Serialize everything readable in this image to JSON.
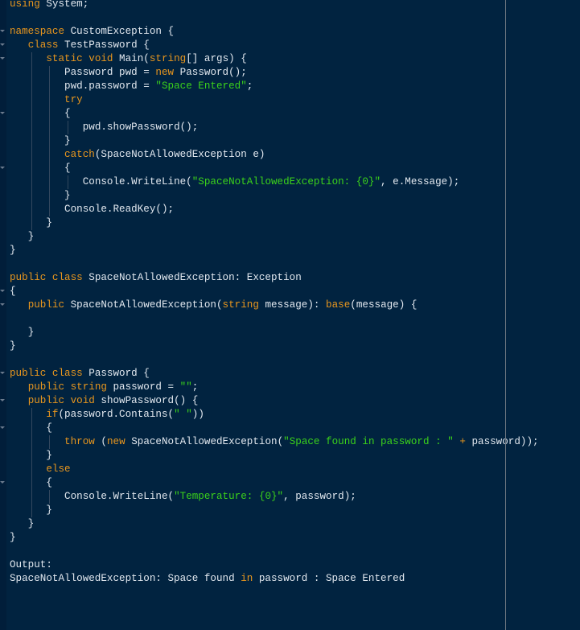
{
  "editor": {
    "indent_unit": "   ",
    "colors": {
      "background": "#012340",
      "keyword": "#e8961e",
      "string": "#3bd21a",
      "text": "#e2e8ef",
      "ruler": "#6e7781"
    },
    "lines": [
      {
        "indent": 0,
        "fold": false,
        "tokens": [
          {
            "t": "using",
            "k": "kw"
          },
          {
            "t": " System;"
          }
        ]
      },
      {
        "indent": 0,
        "fold": false,
        "tokens": []
      },
      {
        "indent": 0,
        "fold": true,
        "tokens": [
          {
            "t": "namespace",
            "k": "kw"
          },
          {
            "t": " CustomException {"
          }
        ]
      },
      {
        "indent": 1,
        "fold": true,
        "tokens": [
          {
            "t": "class",
            "k": "kw"
          },
          {
            "t": " TestPassword {"
          }
        ]
      },
      {
        "indent": 2,
        "fold": true,
        "tokens": [
          {
            "t": "static void",
            "k": "kw"
          },
          {
            "t": " Main("
          },
          {
            "t": "string",
            "k": "kw"
          },
          {
            "t": "[] args) {"
          }
        ]
      },
      {
        "indent": 3,
        "fold": false,
        "tokens": [
          {
            "t": "Password pwd = "
          },
          {
            "t": "new",
            "k": "kw"
          },
          {
            "t": " Password();"
          }
        ]
      },
      {
        "indent": 3,
        "fold": false,
        "tokens": [
          {
            "t": "pwd.password = "
          },
          {
            "t": "\"Space Entered\"",
            "k": "str"
          },
          {
            "t": ";"
          }
        ]
      },
      {
        "indent": 3,
        "fold": false,
        "tokens": [
          {
            "t": "try",
            "k": "kw"
          }
        ]
      },
      {
        "indent": 3,
        "fold": true,
        "tokens": [
          {
            "t": "{"
          }
        ]
      },
      {
        "indent": 4,
        "fold": false,
        "tokens": [
          {
            "t": "pwd.showPassword();"
          }
        ]
      },
      {
        "indent": 3,
        "fold": false,
        "tokens": [
          {
            "t": "}"
          }
        ]
      },
      {
        "indent": 3,
        "fold": false,
        "tokens": [
          {
            "t": "catch",
            "k": "kw"
          },
          {
            "t": "(SpaceNotAllowedException e)"
          }
        ]
      },
      {
        "indent": 3,
        "fold": true,
        "tokens": [
          {
            "t": "{"
          }
        ]
      },
      {
        "indent": 4,
        "fold": false,
        "tokens": [
          {
            "t": "Console.WriteLine("
          },
          {
            "t": "\"SpaceNotAllowedException: {0}\"",
            "k": "str"
          },
          {
            "t": ", e.Message);"
          }
        ]
      },
      {
        "indent": 3,
        "fold": false,
        "tokens": [
          {
            "t": "}"
          }
        ]
      },
      {
        "indent": 3,
        "fold": false,
        "tokens": [
          {
            "t": "Console.ReadKey();"
          }
        ]
      },
      {
        "indent": 2,
        "fold": false,
        "tokens": [
          {
            "t": "}"
          }
        ]
      },
      {
        "indent": 1,
        "fold": false,
        "tokens": [
          {
            "t": "}"
          }
        ]
      },
      {
        "indent": 0,
        "fold": false,
        "tokens": [
          {
            "t": "}"
          }
        ]
      },
      {
        "indent": 0,
        "fold": false,
        "tokens": []
      },
      {
        "indent": 0,
        "fold": false,
        "tokens": [
          {
            "t": "public class",
            "k": "kw"
          },
          {
            "t": " SpaceNotAllowedException: Exception"
          }
        ]
      },
      {
        "indent": 0,
        "fold": true,
        "tokens": [
          {
            "t": "{"
          }
        ]
      },
      {
        "indent": 1,
        "fold": true,
        "tokens": [
          {
            "t": "public",
            "k": "kw"
          },
          {
            "t": " SpaceNotAllowedException("
          },
          {
            "t": "string",
            "k": "kw"
          },
          {
            "t": " message): "
          },
          {
            "t": "base",
            "k": "kw"
          },
          {
            "t": "(message) {"
          }
        ]
      },
      {
        "indent": 0,
        "fold": false,
        "tokens": []
      },
      {
        "indent": 1,
        "fold": false,
        "tokens": [
          {
            "t": "}"
          }
        ]
      },
      {
        "indent": 0,
        "fold": false,
        "tokens": [
          {
            "t": "}"
          }
        ]
      },
      {
        "indent": 0,
        "fold": false,
        "tokens": []
      },
      {
        "indent": 0,
        "fold": true,
        "tokens": [
          {
            "t": "public class",
            "k": "kw"
          },
          {
            "t": " Password {"
          }
        ]
      },
      {
        "indent": 1,
        "fold": false,
        "tokens": [
          {
            "t": "public string",
            "k": "kw"
          },
          {
            "t": " password = "
          },
          {
            "t": "\"\"",
            "k": "str"
          },
          {
            "t": ";"
          }
        ]
      },
      {
        "indent": 1,
        "fold": true,
        "tokens": [
          {
            "t": "public void",
            "k": "kw"
          },
          {
            "t": " showPassword() {"
          }
        ]
      },
      {
        "indent": 2,
        "fold": false,
        "tokens": [
          {
            "t": "if",
            "k": "kw"
          },
          {
            "t": "(password.Contains("
          },
          {
            "t": "\" \"",
            "k": "str"
          },
          {
            "t": "))"
          }
        ]
      },
      {
        "indent": 2,
        "fold": true,
        "tokens": [
          {
            "t": "{"
          }
        ]
      },
      {
        "indent": 3,
        "fold": false,
        "tokens": [
          {
            "t": "throw",
            "k": "kw"
          },
          {
            "t": " ("
          },
          {
            "t": "new",
            "k": "kw"
          },
          {
            "t": " SpaceNotAllowedException("
          },
          {
            "t": "\"Space found in password : \"",
            "k": "str"
          },
          {
            "t": " "
          },
          {
            "t": "+",
            "k": "kw"
          },
          {
            "t": " password));"
          }
        ]
      },
      {
        "indent": 2,
        "fold": false,
        "tokens": [
          {
            "t": "}"
          }
        ]
      },
      {
        "indent": 2,
        "fold": false,
        "tokens": [
          {
            "t": "else",
            "k": "kw"
          }
        ]
      },
      {
        "indent": 2,
        "fold": true,
        "tokens": [
          {
            "t": "{"
          }
        ]
      },
      {
        "indent": 3,
        "fold": false,
        "tokens": [
          {
            "t": "Console.WriteLine("
          },
          {
            "t": "\"Temperature: {0}\"",
            "k": "str"
          },
          {
            "t": ", password);"
          }
        ]
      },
      {
        "indent": 2,
        "fold": false,
        "tokens": [
          {
            "t": "}"
          }
        ]
      },
      {
        "indent": 1,
        "fold": false,
        "tokens": [
          {
            "t": "}"
          }
        ]
      },
      {
        "indent": 0,
        "fold": false,
        "tokens": [
          {
            "t": "}"
          }
        ]
      },
      {
        "indent": 0,
        "fold": false,
        "tokens": []
      },
      {
        "indent": 0,
        "fold": false,
        "tokens": [
          {
            "t": "Output:"
          }
        ]
      },
      {
        "indent": 0,
        "fold": false,
        "tokens": [
          {
            "t": "SpaceNotAllowedException: Space found "
          },
          {
            "t": "in",
            "k": "kw"
          },
          {
            "t": " password : Space Entered"
          }
        ]
      }
    ]
  }
}
